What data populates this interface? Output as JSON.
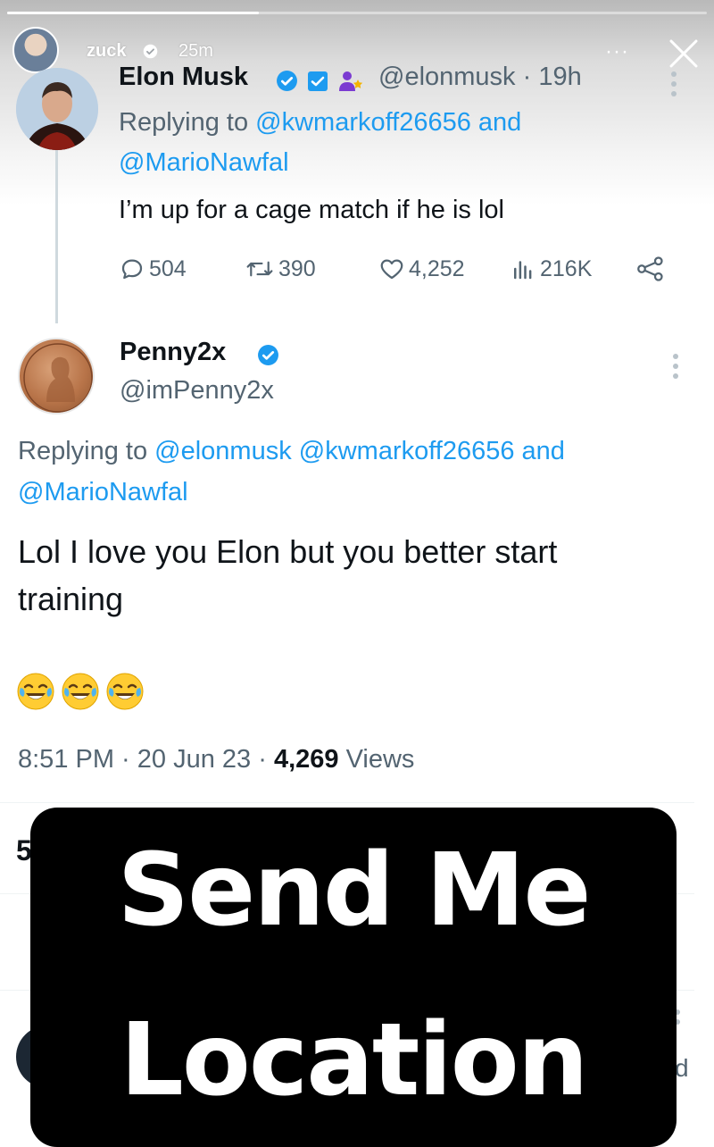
{
  "story": {
    "progress": 0.36,
    "username": "zuck",
    "time": "25m",
    "more_label": "···"
  },
  "tweet1": {
    "author": "Elon Musk",
    "handle_time": "@elonmusk · 19h",
    "reply_prefix": "Replying to ",
    "reply_handle1": "@kwmarkoff26656",
    "reply_and": " and",
    "reply_handle2": "@MarioNawfal",
    "text": "I’m up for a cage match if he is lol",
    "replies": "504",
    "retweets": "390",
    "likes": "4,252",
    "views": "216K"
  },
  "tweet2": {
    "author": "Penny2x",
    "handle": "@imPenny2x",
    "reply_prefix": "Replying to ",
    "reply_handle1": "@elonmusk",
    "reply_handle2": "@kwmarkoff26656",
    "reply_and": "and",
    "reply_handle3": "@MarioNawfal",
    "text_line1": "Lol I love you Elon but you better start",
    "text_line2": "training",
    "emoji_count": 3,
    "time": "8:51 PM · 20 Jun 23 · ",
    "views_count": "4,269",
    "views_label": " Views"
  },
  "partial": {
    "digit": "5",
    "letter": "d"
  },
  "sticker": {
    "line1": "Send Me",
    "line2": "Location"
  },
  "colors": {
    "link": "#1d9bf0",
    "verified": "#1d9bf0",
    "muted": "#536471",
    "sticker_bg": "#000000"
  }
}
